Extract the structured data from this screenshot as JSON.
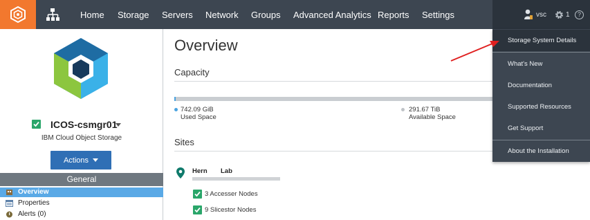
{
  "header": {
    "nav_items": [
      "Home",
      "Storage",
      "Servers",
      "Network",
      "Groups",
      "Advanced Analytics",
      "Reports",
      "Settings"
    ],
    "user_label": "vsc",
    "settings_count": "1",
    "help_symbol": "?"
  },
  "sidebar": {
    "system_name": "ICOS-csmgr01",
    "system_subtitle": "IBM Cloud Object Storage",
    "actions_label": "Actions",
    "section_header": "General",
    "items": [
      {
        "label": "Overview",
        "icon": "building-icon",
        "active": true
      },
      {
        "label": "Properties",
        "icon": "properties-icon",
        "active": false
      },
      {
        "label": "Alerts (0)",
        "icon": "alert-icon",
        "active": false
      }
    ]
  },
  "main": {
    "title": "Overview",
    "capacity": {
      "heading": "Capacity",
      "used_value": "742.09 GiB",
      "used_label": "Used Space",
      "available_value": "291.67 TiB",
      "available_label": "Available Space",
      "used_fraction": 0.0025
    },
    "sites": {
      "heading": "Sites",
      "site_name_1": "Hern",
      "site_name_2": "Lab",
      "nodes": [
        "3 Accesser Nodes",
        "9 Slicestor Nodes"
      ]
    }
  },
  "dropdown": {
    "items": [
      "Storage System Details",
      "What's New",
      "Documentation",
      "Supported Resources",
      "Get Support",
      "About the Installation"
    ]
  },
  "colors": {
    "header_bg": "#3d4651",
    "logo_orange": "#f2782e",
    "accent_blue": "#2f6fb5",
    "active_row": "#5aa9e6",
    "check_green": "#2aa66a",
    "annotation_red": "#e02020"
  }
}
